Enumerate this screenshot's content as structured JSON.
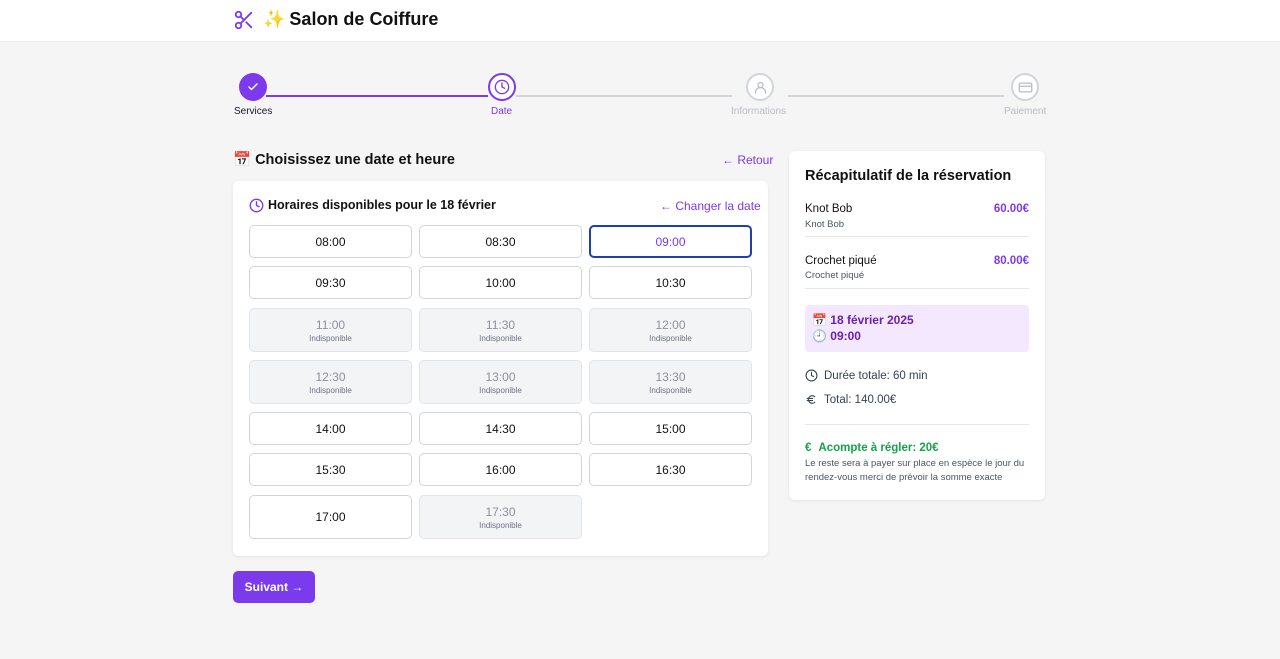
{
  "header": {
    "brand": "Salon de Coiffure",
    "logo_icon": "scissors-icon",
    "brand_emoji": "✨",
    "accent": "#7c3aed"
  },
  "steps": [
    {
      "label": "Services",
      "state": "done",
      "icon": "check-icon"
    },
    {
      "label": "Date",
      "state": "active",
      "icon": "clock-icon"
    },
    {
      "label": "Informations",
      "state": "todo",
      "icon": "user-icon"
    },
    {
      "label": "Paiement",
      "state": "todo",
      "icon": "card-icon"
    }
  ],
  "main": {
    "title": "📅 Choisissez une date et heure",
    "back": "← Retour",
    "slots_header": "Horaires disponibles pour le 18 février",
    "change_date": "← Changer la date",
    "slots": [
      {
        "time": "08:00",
        "status": "available"
      },
      {
        "time": "08:30",
        "status": "available"
      },
      {
        "time": "09:00",
        "status": "selected"
      },
      {
        "time": "09:30",
        "status": "available"
      },
      {
        "time": "10:00",
        "status": "available"
      },
      {
        "time": "10:30",
        "status": "available"
      },
      {
        "time": "11:00",
        "status": "unavailable",
        "note": "Indisponible"
      },
      {
        "time": "11:30",
        "status": "unavailable",
        "note": "Indisponible"
      },
      {
        "time": "12:00",
        "status": "unavailable",
        "note": "Indisponible"
      },
      {
        "time": "12:30",
        "status": "unavailable",
        "note": "Indisponible"
      },
      {
        "time": "13:00",
        "status": "unavailable",
        "note": "Indisponible"
      },
      {
        "time": "13:30",
        "status": "unavailable",
        "note": "Indisponible"
      },
      {
        "time": "14:00",
        "status": "available"
      },
      {
        "time": "14:30",
        "status": "available"
      },
      {
        "time": "15:00",
        "status": "available"
      },
      {
        "time": "15:30",
        "status": "available"
      },
      {
        "time": "16:00",
        "status": "available"
      },
      {
        "time": "16:30",
        "status": "available"
      },
      {
        "time": "17:00",
        "status": "available"
      },
      {
        "time": "17:30",
        "status": "unavailable",
        "note": "Indisponible"
      }
    ],
    "next": "Suivant →"
  },
  "summary": {
    "title": "Récapitulatif de la réservation",
    "items": [
      {
        "name": "Knot Bob",
        "sub": "Knot Bob",
        "price": "60.00€"
      },
      {
        "name": "Crochet piqué",
        "sub": "Crochet piqué",
        "price": "80.00€"
      }
    ],
    "date": "📅 18 février 2025",
    "time": "🕘 09:00",
    "duration": "Durée totale: 60 min",
    "total": "Total: 140.00€",
    "deposit": "Acompte à régler: 20€",
    "deposit_symbol": "€",
    "note": "Le reste sera à payer sur place en espèce le jour du rendez-vous merci de prévoir la somme exacte"
  }
}
